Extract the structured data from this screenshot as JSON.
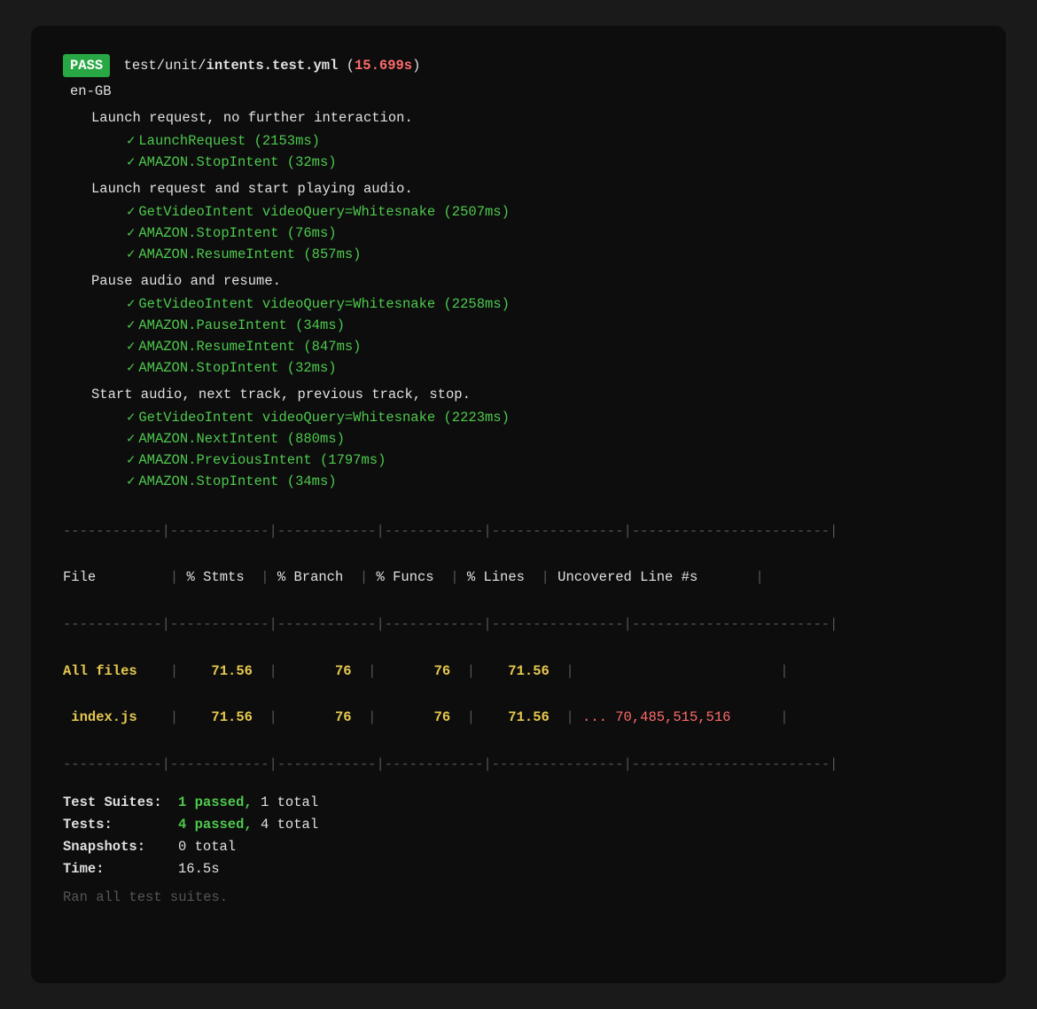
{
  "terminal": {
    "pass_badge": "PASS",
    "title_path": "test/unit/",
    "title_file": "intents.test.yml",
    "title_time": "15.699s",
    "locale": "en-GB",
    "sections": [
      {
        "header": "Launch request, no further interaction.",
        "tests": [
          {
            "name": "LaunchRequest",
            "time": "2153ms"
          },
          {
            "name": "AMAZON.StopIntent",
            "time": "32ms"
          }
        ]
      },
      {
        "header": "Launch request and start playing audio.",
        "tests": [
          {
            "name": "GetVideoIntent videoQuery=Whitesnake",
            "time": "2507ms"
          },
          {
            "name": "AMAZON.StopIntent",
            "time": "76ms"
          },
          {
            "name": "AMAZON.ResumeIntent",
            "time": "857ms"
          }
        ]
      },
      {
        "header": "Pause audio and resume.",
        "tests": [
          {
            "name": "GetVideoIntent videoQuery=Whitesnake",
            "time": "2258ms"
          },
          {
            "name": "AMAZON.PauseIntent",
            "time": "34ms"
          },
          {
            "name": "AMAZON.ResumeIntent",
            "time": "847ms"
          },
          {
            "name": "AMAZON.StopIntent",
            "time": "32ms"
          }
        ]
      },
      {
        "header": "Start audio, next track, previous track, stop.",
        "tests": [
          {
            "name": "GetVideoIntent videoQuery=Whitesnake",
            "time": "2223ms"
          },
          {
            "name": "AMAZON.NextIntent",
            "time": "880ms"
          },
          {
            "name": "AMAZON.PreviousIntent",
            "time": "1797ms"
          },
          {
            "name": "AMAZON.StopIntent",
            "time": "34ms"
          }
        ]
      }
    ],
    "table": {
      "divider_top": "------------|------------|------------|------------|----------------|------------------------|",
      "headers": [
        "File",
        "% Stmts",
        "% Branch",
        "% Funcs",
        "% Lines",
        "Uncovered Line #s"
      ],
      "divider_mid": "------------|------------|------------|------------|----------------|------------------------|",
      "rows": [
        {
          "file": "All files",
          "stmts": "71.56",
          "branch": "76",
          "funcs": "76",
          "lines": "71.56",
          "uncovered": "",
          "type": "all-files"
        },
        {
          "file": "index.js",
          "stmts": "71.56",
          "branch": "76",
          "funcs": "76",
          "lines": "71.56",
          "uncovered": "... 70,485,515,516",
          "type": "index"
        }
      ],
      "divider_bot": "------------|------------|------------|------------|----------------|------------------------|"
    },
    "summary": {
      "suites_label": "Test Suites:",
      "suites_passed": "1 passed,",
      "suites_total": "1 total",
      "tests_label": "Tests:",
      "tests_passed": "4 passed,",
      "tests_total": "4 total",
      "snapshots_label": "Snapshots:",
      "snapshots_value": "0 total",
      "time_label": "Time:",
      "time_value": "16.5s",
      "ran_line": "Ran all test suites."
    }
  }
}
